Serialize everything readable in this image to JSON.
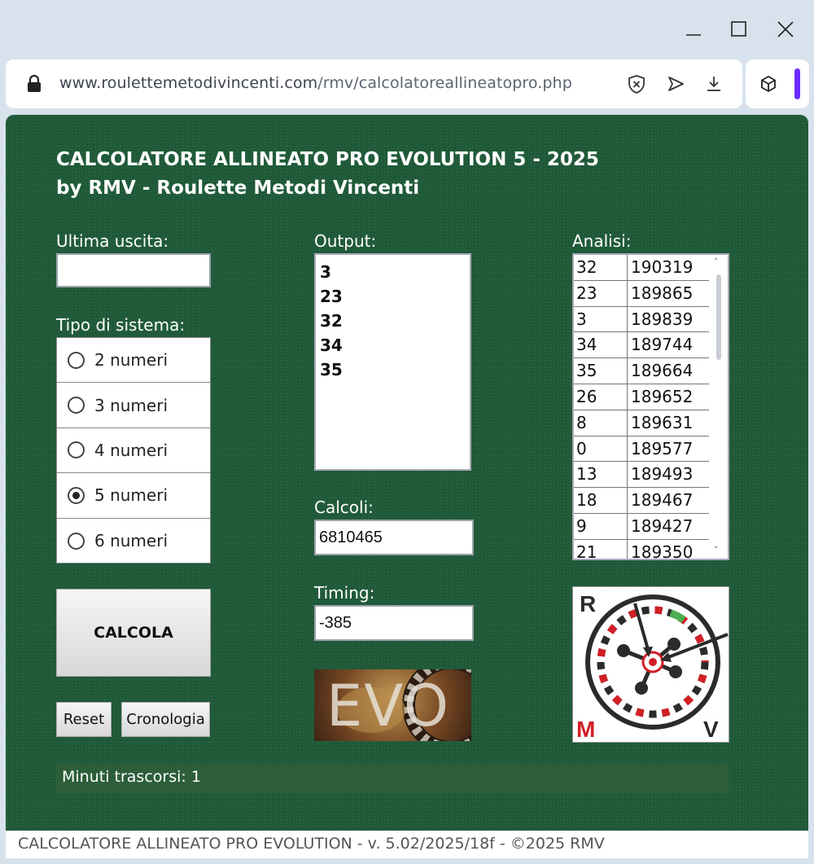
{
  "browser": {
    "url_domain": "www.roulettemetodivincenti.com",
    "url_path": "/rmv/calcolatoreallineatopro.php"
  },
  "page": {
    "title_line1": "CALCOLATORE ALLINEATO PRO EVOLUTION 5 - 2025",
    "title_line2": "by RMV - Roulette Metodi Vincenti",
    "ultima_label": "Ultima uscita:",
    "ultima_value": "",
    "tipo_label": "Tipo di sistema:",
    "systems": [
      {
        "label": "2 numeri",
        "selected": false
      },
      {
        "label": "3 numeri",
        "selected": false
      },
      {
        "label": "4 numeri",
        "selected": false
      },
      {
        "label": "5 numeri",
        "selected": true
      },
      {
        "label": "6 numeri",
        "selected": false
      }
    ],
    "calcola_label": "CALCOLA",
    "reset_label": "Reset",
    "cronologia_label": "Cronologia",
    "output_label": "Output:",
    "output_values": [
      "3",
      "23",
      "32",
      "34",
      "35"
    ],
    "calcoli_label": "Calcoli:",
    "calcoli_value": "6810465",
    "timing_label": "Timing:",
    "timing_value": "-385",
    "evo_text": "EVO",
    "analisi_label": "Analisi:",
    "analisi_rows": [
      [
        "32",
        "190319"
      ],
      [
        "23",
        "189865"
      ],
      [
        "3",
        "189839"
      ],
      [
        "34",
        "189744"
      ],
      [
        "35",
        "189664"
      ],
      [
        "26",
        "189652"
      ],
      [
        "8",
        "189631"
      ],
      [
        "0",
        "189577"
      ],
      [
        "13",
        "189493"
      ],
      [
        "18",
        "189467"
      ],
      [
        "9",
        "189427"
      ],
      [
        "21",
        "189350"
      ]
    ],
    "logo_letters": {
      "r": "R",
      "m": "M",
      "v": "V"
    },
    "minuti_text": "Minuti trascorsi: 1",
    "footer_text": "CALCOLATORE ALLINEATO PRO EVOLUTION - v. 5.02/2025/18f - ©2025 RMV"
  },
  "colors": {
    "felt": "#1f5a38",
    "brand_red": "#d21f26"
  }
}
